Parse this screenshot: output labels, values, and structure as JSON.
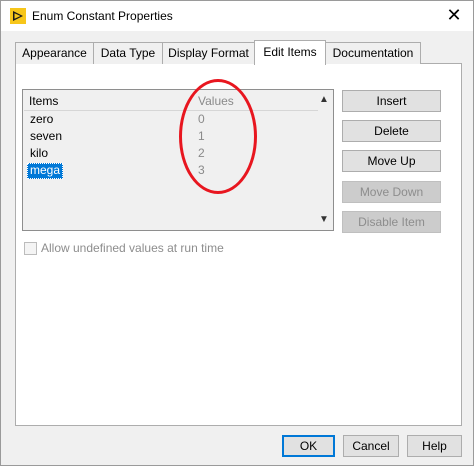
{
  "window": {
    "title": "Enum Constant Properties",
    "close_glyph": "✕"
  },
  "tabs": [
    {
      "label": "Appearance",
      "active": false
    },
    {
      "label": "Data Type",
      "active": false
    },
    {
      "label": "Display Format",
      "active": false
    },
    {
      "label": "Edit Items",
      "active": true
    },
    {
      "label": "Documentation",
      "active": false
    }
  ],
  "list": {
    "header_items": "Items",
    "header_values": "Values",
    "rows": [
      {
        "item": "zero",
        "value": "0",
        "selected": false
      },
      {
        "item": "seven",
        "value": "1",
        "selected": false
      },
      {
        "item": "kilo",
        "value": "2",
        "selected": false
      },
      {
        "item": "mega",
        "value": "3",
        "selected": true
      }
    ],
    "scroll_up_glyph": "▲",
    "scroll_down_glyph": "▼"
  },
  "side_buttons": {
    "insert": "Insert",
    "delete": "Delete",
    "move_up": "Move Up",
    "move_down": "Move Down",
    "disable_item": "Disable Item"
  },
  "checkbox": {
    "label": "Allow undefined values at run time",
    "checked": false
  },
  "footer": {
    "ok": "OK",
    "cancel": "Cancel",
    "help": "Help"
  },
  "colors": {
    "selection": "#0078d7",
    "annotation": "#e8161f",
    "app_icon": "#f7c61a"
  },
  "icons": {
    "app": "labview-run-arrow-icon",
    "close": "close-icon"
  }
}
